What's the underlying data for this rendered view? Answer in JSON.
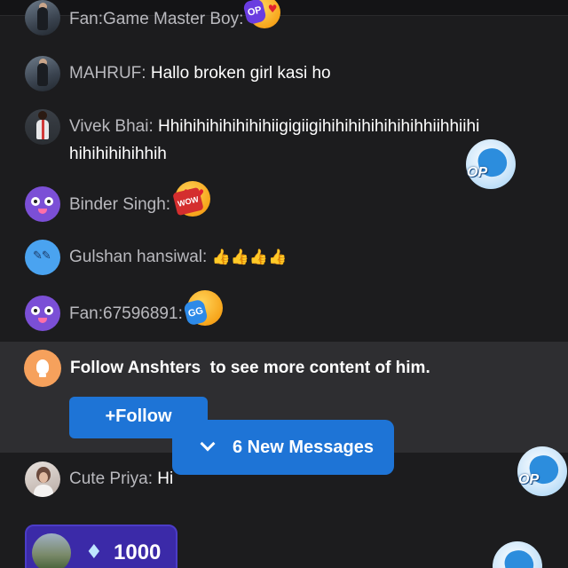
{
  "messages": [
    {
      "name": "Fan:Game Master Boy",
      "text": ""
    },
    {
      "name": "MAHRUF",
      "text": "Hallo broken girl kasi ho"
    },
    {
      "name": "Vivek Bhai",
      "text": "Hhihihihihihihihiigigiigihihihihihihihihhiihhiihi",
      "text2": "hihihihihihhih"
    },
    {
      "name": "Binder Singh",
      "text": "",
      "sticker_tag": "WOW"
    },
    {
      "name": "Gulshan hansiwal",
      "text": "👍👍👍👍"
    },
    {
      "name": "Fan:67596891",
      "text": "",
      "sticker_tag": "GG"
    },
    {
      "name": "Cute Priya",
      "text": "Hi"
    }
  ],
  "op_label": "OP",
  "follow": {
    "text": "Follow Anshters  to see more content of him.",
    "button": "+Follow"
  },
  "new_messages": "6 New Messages",
  "gift": {
    "amount": "1000"
  },
  "colors": {
    "background": "#1c1c1e",
    "accent": "#1e74d6",
    "panel": "#2e2e31",
    "gift": "#3b2aa8"
  },
  "icons": [
    "lightbulb-icon",
    "chevron-down-icon",
    "diamond-icon",
    "op-badge-icon"
  ]
}
